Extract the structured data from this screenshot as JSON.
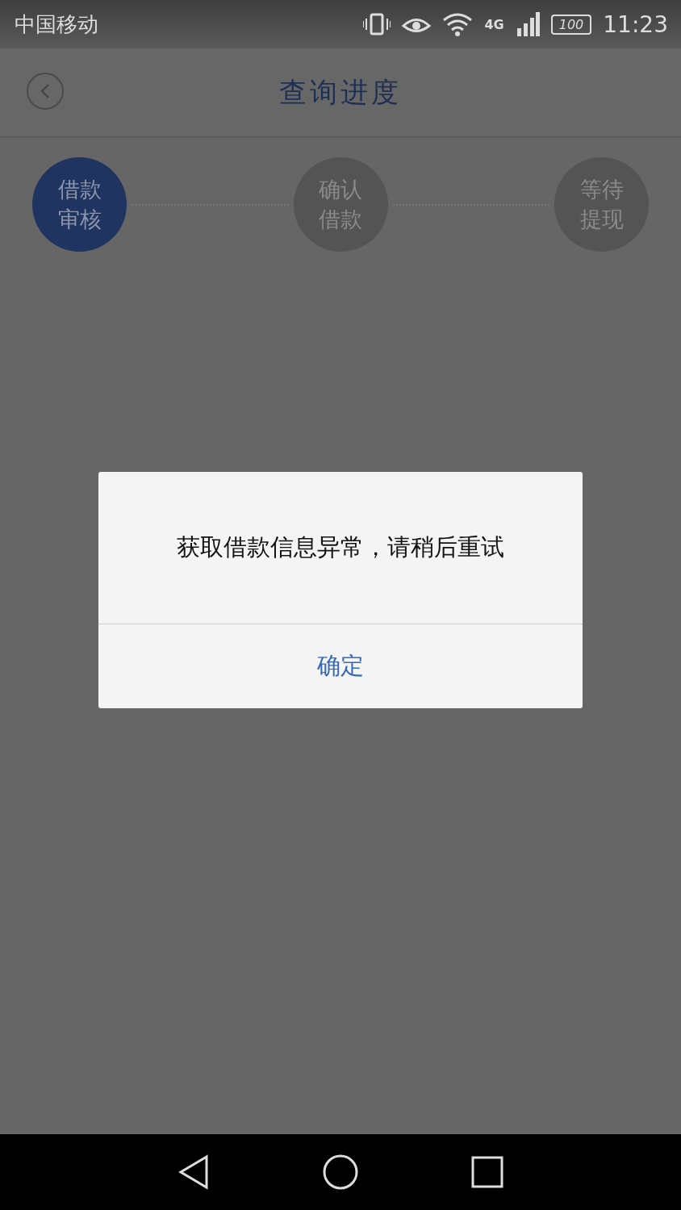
{
  "status_bar": {
    "carrier": "中国移动",
    "network": "4G",
    "battery": "100",
    "time": "11:23"
  },
  "header": {
    "title": "查询进度"
  },
  "steps": [
    {
      "label": "借款审核",
      "selected": true
    },
    {
      "label": "确认借款",
      "selected": false
    },
    {
      "label": "等待提现",
      "selected": false
    }
  ],
  "dialog": {
    "message": "获取借款信息异常，请稍后重试",
    "button": "确定"
  }
}
